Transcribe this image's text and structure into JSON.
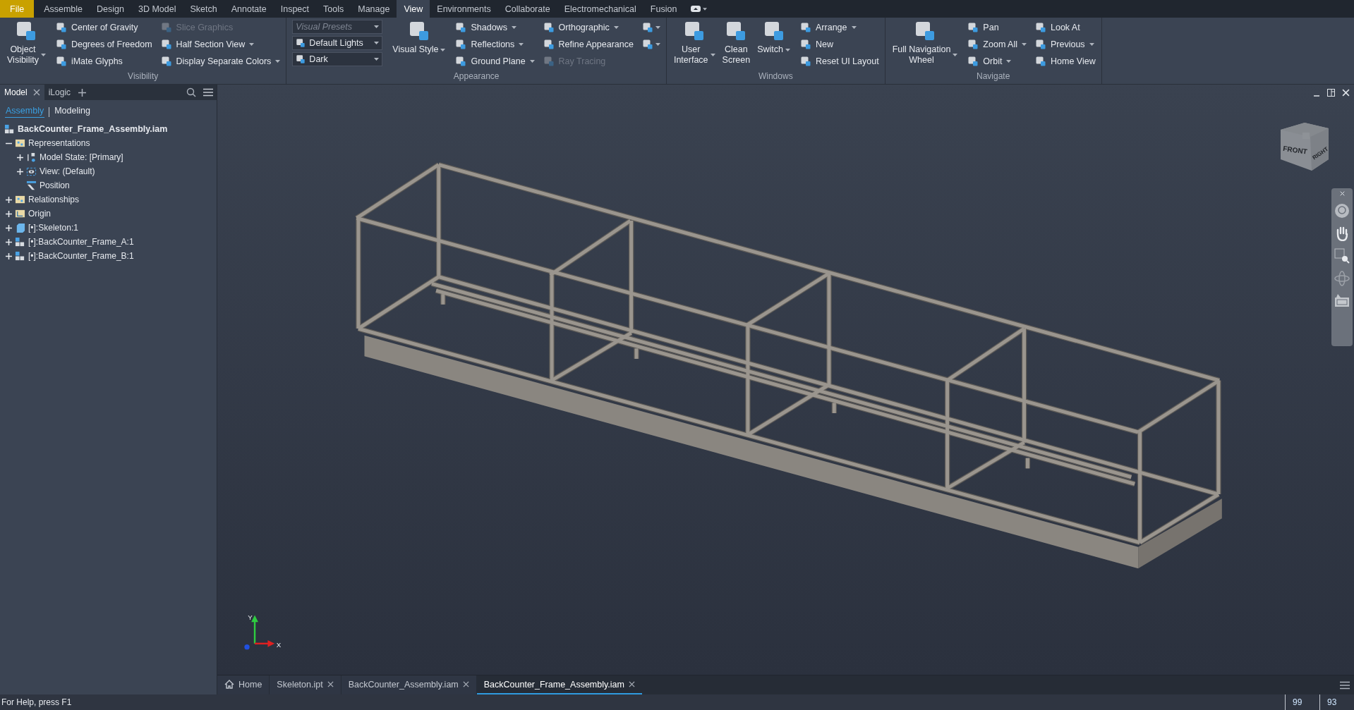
{
  "menu_tabs": [
    {
      "label": "File",
      "kind": "app",
      "selected": false
    },
    {
      "label": "Assemble",
      "kind": "tab",
      "selected": false
    },
    {
      "label": "Design",
      "kind": "tab",
      "selected": false
    },
    {
      "label": "3D Model",
      "kind": "tab",
      "selected": false
    },
    {
      "label": "Sketch",
      "kind": "tab",
      "selected": false
    },
    {
      "label": "Annotate",
      "kind": "tab",
      "selected": false
    },
    {
      "label": "Inspect",
      "kind": "tab",
      "selected": false
    },
    {
      "label": "Tools",
      "kind": "tab",
      "selected": false
    },
    {
      "label": "Manage",
      "kind": "tab",
      "selected": false
    },
    {
      "label": "View",
      "kind": "tab",
      "selected": true
    },
    {
      "label": "Environments",
      "kind": "tab",
      "selected": false
    },
    {
      "label": "Collaborate",
      "kind": "tab",
      "selected": false
    },
    {
      "label": "Electromechanical",
      "kind": "tab",
      "selected": false
    },
    {
      "label": "Fusion",
      "kind": "tab",
      "selected": false
    }
  ],
  "ribbon": {
    "panels": [
      {
        "title": "Visibility",
        "columns": [
          {
            "kind": "large",
            "items": [
              {
                "label": "Object\nVisibility",
                "menu": true,
                "disabled": false
              }
            ]
          },
          {
            "kind": "small",
            "items": [
              {
                "label": "Center of Gravity",
                "menu": false,
                "disabled": false
              },
              {
                "label": "Degrees of Freedom",
                "menu": false,
                "disabled": false
              },
              {
                "label": "iMate Glyphs",
                "menu": false,
                "disabled": false
              }
            ]
          },
          {
            "kind": "small",
            "items": [
              {
                "label": "Slice Graphics",
                "menu": false,
                "disabled": true
              },
              {
                "label": "Half Section View",
                "menu": true,
                "disabled": false
              },
              {
                "label": "Display Separate Colors",
                "menu": true,
                "disabled": false
              }
            ]
          }
        ]
      },
      {
        "title": "Appearance",
        "columns": [
          {
            "kind": "combo",
            "items": [
              {
                "placeholder": "Visual Presets"
              },
              {
                "value": "Default Lights"
              },
              {
                "value": "Dark"
              }
            ]
          },
          {
            "kind": "large",
            "items": [
              {
                "label": "Visual Style",
                "menu": true,
                "disabled": false
              }
            ]
          },
          {
            "kind": "small",
            "items": [
              {
                "label": "Shadows",
                "menu": true,
                "disabled": false
              },
              {
                "label": "Reflections",
                "menu": true,
                "disabled": false
              },
              {
                "label": "Ground Plane",
                "menu": true,
                "disabled": false
              }
            ]
          },
          {
            "kind": "small",
            "items": [
              {
                "label": "Orthographic",
                "menu": true,
                "disabled": false
              },
              {
                "label": "Refine Appearance",
                "menu": false,
                "disabled": false
              },
              {
                "label": "Ray Tracing",
                "menu": false,
                "disabled": true
              }
            ]
          },
          {
            "kind": "icons",
            "items": [
              {
                "menu": true,
                "disabled": false
              },
              {
                "menu": true,
                "disabled": false
              }
            ]
          }
        ]
      },
      {
        "title": "Windows",
        "columns": [
          {
            "kind": "large",
            "items": [
              {
                "label": "User\nInterface",
                "menu": true,
                "disabled": false
              },
              {
                "label": "Clean\nScreen",
                "menu": false,
                "disabled": false
              },
              {
                "label": "Switch",
                "menu": true,
                "disabled": false
              }
            ]
          },
          {
            "kind": "small",
            "items": [
              {
                "label": "Arrange",
                "menu": true,
                "disabled": false
              },
              {
                "label": "New",
                "menu": false,
                "disabled": false
              },
              {
                "label": "Reset UI Layout",
                "menu": false,
                "disabled": false
              }
            ]
          }
        ]
      },
      {
        "title": "Navigate",
        "columns": [
          {
            "kind": "large",
            "items": [
              {
                "label": "Full Navigation\nWheel",
                "menu": true,
                "disabled": false
              }
            ]
          },
          {
            "kind": "small",
            "items": [
              {
                "label": "Pan",
                "menu": false,
                "disabled": false
              },
              {
                "label": "Zoom All",
                "menu": true,
                "disabled": false
              },
              {
                "label": "Orbit",
                "menu": true,
                "disabled": false
              }
            ]
          },
          {
            "kind": "small",
            "items": [
              {
                "label": "Look At",
                "menu": false,
                "disabled": false
              },
              {
                "label": "Previous",
                "menu": true,
                "disabled": false
              },
              {
                "label": "Home View",
                "menu": false,
                "disabled": false
              }
            ]
          }
        ]
      }
    ]
  },
  "browser": {
    "tabs": [
      {
        "label": "Model",
        "selected": true
      },
      {
        "label": "iLogic",
        "selected": false
      }
    ],
    "modes": [
      {
        "label": "Assembly",
        "selected": true
      },
      {
        "label": "Modeling",
        "selected": false
      }
    ],
    "tree": {
      "label": "BackCounter_Frame_Assembly.iam",
      "kind": "assembly",
      "children": [
        {
          "label": "Representations",
          "kind": "folder",
          "expanded": true,
          "children": [
            {
              "label": "Model State: [Primary]",
              "kind": "state",
              "expanded": false
            },
            {
              "label": "View: (Default)",
              "kind": "view",
              "expanded": false
            },
            {
              "label": "Position",
              "kind": "position"
            }
          ]
        },
        {
          "label": "Relationships",
          "kind": "folder",
          "expanded": false
        },
        {
          "label": "Origin",
          "kind": "origin",
          "expanded": false
        },
        {
          "label": "[•]:Skeleton:1",
          "kind": "part",
          "expanded": false
        },
        {
          "label": "[•]:BackCounter_Frame_A:1",
          "kind": "assembly",
          "expanded": false
        },
        {
          "label": "[•]:BackCounter_Frame_B:1",
          "kind": "assembly",
          "expanded": false
        }
      ]
    }
  },
  "viewport": {
    "view_cube": [
      "FRONT",
      "RIGHT"
    ],
    "axes": [
      "Y",
      "X"
    ]
  },
  "document_tabs": [
    {
      "label": "Home",
      "kind": "home",
      "selected": false
    },
    {
      "label": "Skeleton.ipt",
      "kind": "file",
      "selected": false
    },
    {
      "label": "BackCounter_Assembly.iam",
      "kind": "file",
      "selected": false
    },
    {
      "label": "BackCounter_Frame_Assembly.iam",
      "kind": "file",
      "selected": true
    }
  ],
  "status_bar": {
    "help": "For Help, press F1",
    "counts": [
      "99",
      "93"
    ]
  }
}
